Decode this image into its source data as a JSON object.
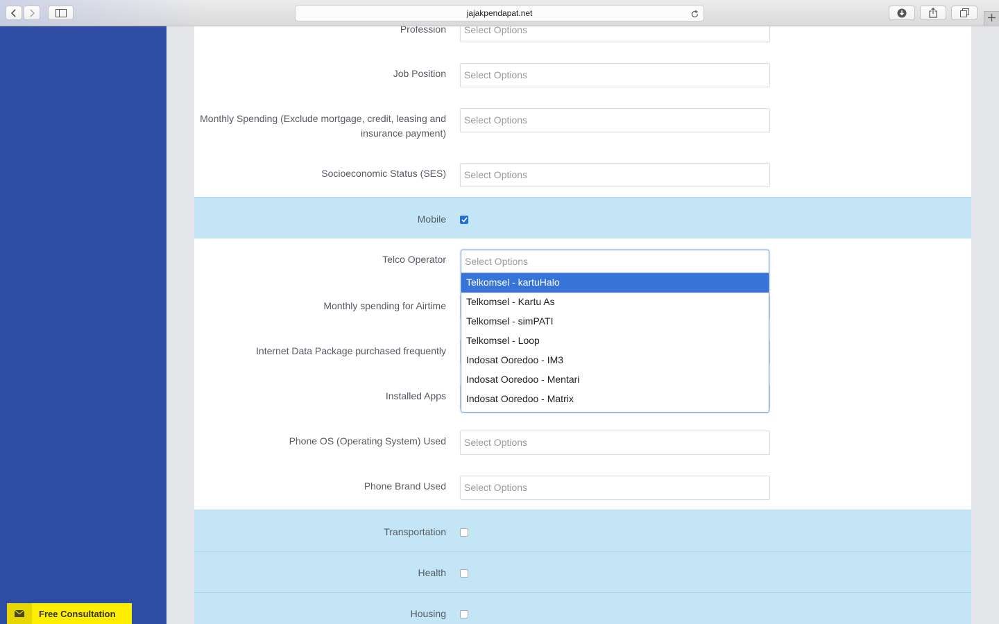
{
  "browser": {
    "url": "jajakpendapat.net"
  },
  "sidebar": {
    "consult_label": "Free Consultation"
  },
  "form": {
    "select_placeholder": "Select Options",
    "rows": {
      "profession": "Profession",
      "job_position": "Job Position",
      "monthly_spending": "Monthly Spending (Exclude mortgage, credit, leasing and insurance payment)",
      "ses": "Socioeconomic Status (SES)",
      "mobile": "Mobile",
      "telco_operator": "Telco Operator",
      "airtime": "Monthly spending for Airtime",
      "data_package": "Internet Data Package purchased frequently",
      "installed_apps": "Installed Apps",
      "phone_os": "Phone OS (Operating System) Used",
      "phone_brand": "Phone Brand Used",
      "transportation": "Transportation",
      "health": "Health",
      "housing": "Housing"
    },
    "checkboxes": {
      "mobile": true,
      "transportation": false,
      "health": false,
      "housing": false
    },
    "telco_dropdown": {
      "search_placeholder": "Select Options",
      "options": [
        "Telkomsel - kartuHalo",
        "Telkomsel - Kartu As",
        "Telkomsel - simPATI",
        "Telkomsel - Loop",
        "Indosat Ooredoo - IM3",
        "Indosat Ooredoo - Mentari",
        "Indosat Ooredoo - Matrix"
      ],
      "highlighted_option": "Telkomsel - kartuHalo"
    }
  },
  "colors": {
    "sidebar": "#2e4ca4",
    "highlight_row": "#c3e5f5",
    "dropdown_active": "#3874d8",
    "consult_button": "#ffee00"
  }
}
